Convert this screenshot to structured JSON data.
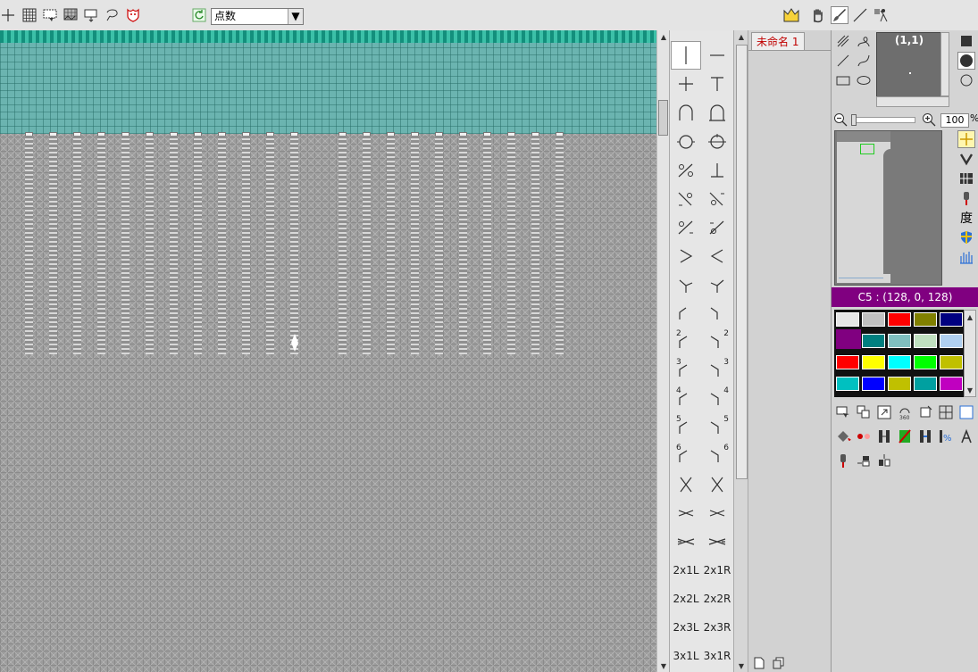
{
  "toolbar": {
    "mode_select_value": "点数",
    "icons_left": [
      "crosshair-icon",
      "grid-icon",
      "select-rect-icon",
      "grid-pattern-icon",
      "select-down-icon",
      "lasso-icon",
      "mask-icon",
      "refresh-icon"
    ],
    "icons_right": [
      "crown-icon",
      "hand-icon",
      "brush-icon",
      "line-icon",
      "figure-icon"
    ]
  },
  "stitch_panel": {
    "labels": [
      "2x1L",
      "2x1R",
      "2x2L",
      "2x2R",
      "2x3L",
      "2x3R",
      "3x1L",
      "3x1R"
    ],
    "number_labels": [
      "2",
      "2",
      "3",
      "3",
      "4",
      "4",
      "5",
      "5",
      "6",
      "6"
    ]
  },
  "document": {
    "tab_label": "未命名 1"
  },
  "navigator": {
    "coord": "(1,1)",
    "zoom_value": "100",
    "zoom_unit": "%"
  },
  "right_tools": {
    "side_text": "度"
  },
  "color": {
    "current_label": "C5 : (128, 0, 128)",
    "current_hex": "#800080",
    "swatches": [
      [
        "#e6e6e6",
        "#c0c0c0",
        "#ff0000",
        "#808000",
        "#000080"
      ],
      [
        "#800080",
        "#008080",
        "#80c0c0",
        "#c0e0c0",
        "#b0d0f0"
      ],
      [
        "#ff0000",
        "#ffff00",
        "#00ffff",
        "#00ff00",
        "#c0c000"
      ],
      [
        "#00c0c0",
        "#0000ff",
        "#c0c000",
        "#00a0a0",
        "#c000c0"
      ]
    ]
  }
}
